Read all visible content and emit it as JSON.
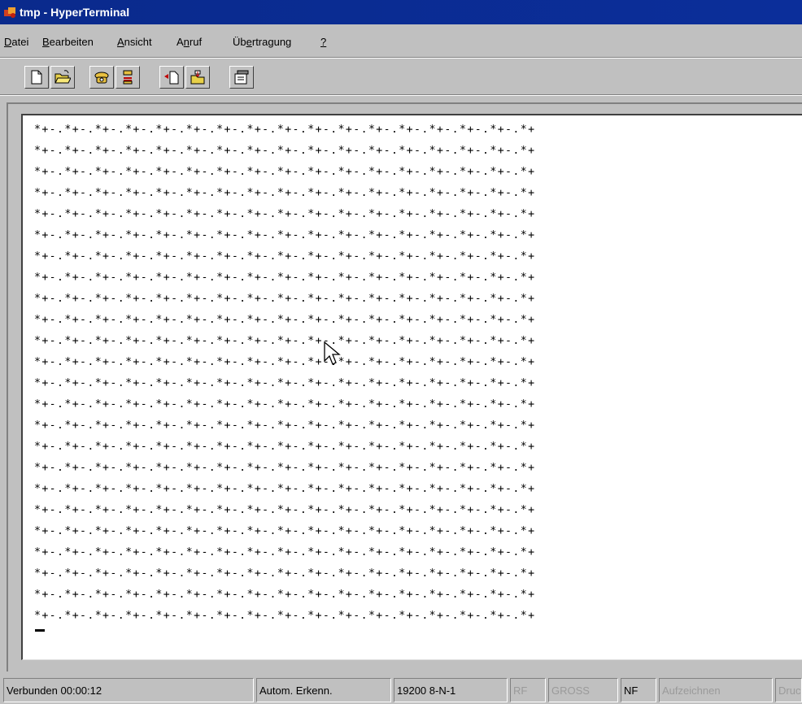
{
  "window": {
    "title": "tmp - HyperTerminal",
    "app_icon": "hyperterminal-icon"
  },
  "menu": [
    {
      "prefix": "",
      "accel": "D",
      "suffix": "atei"
    },
    {
      "prefix": "",
      "accel": "B",
      "suffix": "earbeiten"
    },
    {
      "prefix": "",
      "accel": "A",
      "suffix": "nsicht"
    },
    {
      "prefix": "A",
      "accel": "n",
      "suffix": "ruf"
    },
    {
      "prefix": "Üb",
      "accel": "e",
      "suffix": "rtragung"
    },
    {
      "prefix": "",
      "accel": "?",
      "suffix": ""
    }
  ],
  "toolbar": [
    {
      "name": "new-connection-icon"
    },
    {
      "name": "open-icon"
    },
    {
      "name": "call-icon"
    },
    {
      "name": "disconnect-icon"
    },
    {
      "name": "send-file-icon"
    },
    {
      "name": "receive-file-icon"
    },
    {
      "name": "properties-icon"
    }
  ],
  "terminal": {
    "lines": [
      "*+-.*+-.*+-.*+-.*+-.*+-.*+-.*+-.*+-.*+-.*+-.*+-.*+-.*+-.*+-.*+-.*+",
      "*+-.*+-.*+-.*+-.*+-.*+-.*+-.*+-.*+-.*+-.*+-.*+-.*+-.*+-.*+-.*+-.*+",
      "*+-.*+-.*+-.*+-.*+-.*+-.*+-.*+-.*+-.*+-.*+-.*+-.*+-.*+-.*+-.*+-.*+",
      "*+-.*+-.*+-.*+-.*+-.*+-.*+-.*+-.*+-.*+-.*+-.*+-.*+-.*+-.*+-.*+-.*+",
      "*+-.*+-.*+-.*+-.*+-.*+-.*+-.*+-.*+-.*+-.*+-.*+-.*+-.*+-.*+-.*+-.*+",
      "*+-.*+-.*+-.*+-.*+-.*+-.*+-.*+-.*+-.*+-.*+-.*+-.*+-.*+-.*+-.*+-.*+",
      "*+-.*+-.*+-.*+-.*+-.*+-.*+-.*+-.*+-.*+-.*+-.*+-.*+-.*+-.*+-.*+-.*+",
      "*+-.*+-.*+-.*+-.*+-.*+-.*+-.*+-.*+-.*+-.*+-.*+-.*+-.*+-.*+-.*+-.*+",
      "*+-.*+-.*+-.*+-.*+-.*+-.*+-.*+-.*+-.*+-.*+-.*+-.*+-.*+-.*+-.*+-.*+",
      "*+-.*+-.*+-.*+-.*+-.*+-.*+-.*+-.*+-.*+-.*+-.*+-.*+-.*+-.*+-.*+-.*+",
      "*+-.*+-.*+-.*+-.*+-.*+-.*+-.*+-.*+-.*+-.*+-.*+-.*+-.*+-.*+-.*+-.*+",
      "*+-.*+-.*+-.*+-.*+-.*+-.*+-.*+-.*+-.*+-.*+-.*+-.*+-.*+-.*+-.*+-.*+",
      "*+-.*+-.*+-.*+-.*+-.*+-.*+-.*+-.*+-.*+-.*+-.*+-.*+-.*+-.*+-.*+-.*+",
      "*+-.*+-.*+-.*+-.*+-.*+-.*+-.*+-.*+-.*+-.*+-.*+-.*+-.*+-.*+-.*+-.*+",
      "*+-.*+-.*+-.*+-.*+-.*+-.*+-.*+-.*+-.*+-.*+-.*+-.*+-.*+-.*+-.*+-.*+",
      "*+-.*+-.*+-.*+-.*+-.*+-.*+-.*+-.*+-.*+-.*+-.*+-.*+-.*+-.*+-.*+-.*+",
      "*+-.*+-.*+-.*+-.*+-.*+-.*+-.*+-.*+-.*+-.*+-.*+-.*+-.*+-.*+-.*+-.*+",
      "*+-.*+-.*+-.*+-.*+-.*+-.*+-.*+-.*+-.*+-.*+-.*+-.*+-.*+-.*+-.*+-.*+",
      "*+-.*+-.*+-.*+-.*+-.*+-.*+-.*+-.*+-.*+-.*+-.*+-.*+-.*+-.*+-.*+-.*+",
      "*+-.*+-.*+-.*+-.*+-.*+-.*+-.*+-.*+-.*+-.*+-.*+-.*+-.*+-.*+-.*+-.*+",
      "*+-.*+-.*+-.*+-.*+-.*+-.*+-.*+-.*+-.*+-.*+-.*+-.*+-.*+-.*+-.*+-.*+",
      "*+-.*+-.*+-.*+-.*+-.*+-.*+-.*+-.*+-.*+-.*+-.*+-.*+-.*+-.*+-.*+-.*+",
      "*+-.*+-.*+-.*+-.*+-.*+-.*+-.*+-.*+-.*+-.*+-.*+-.*+-.*+-.*+-.*+-.*+",
      "*+-.*+-.*+-.*+-.*+-.*+-.*+-.*+-.*+-.*+-.*+-.*+-.*+-.*+-.*+-.*+-.*+"
    ]
  },
  "statusbar": {
    "connection": "Verbunden 00:00:12",
    "detect": "Autom. Erkenn.",
    "settings": "19200 8-N-1",
    "scroll": "RF",
    "caps": "GROSS",
    "num": "NF",
    "capture": "Aufzeichnen",
    "print": "Drucken"
  },
  "colors": {
    "titlebar": "#0a2a8c",
    "face": "#c0c0c0",
    "terminal_bg": "#ffffff"
  }
}
